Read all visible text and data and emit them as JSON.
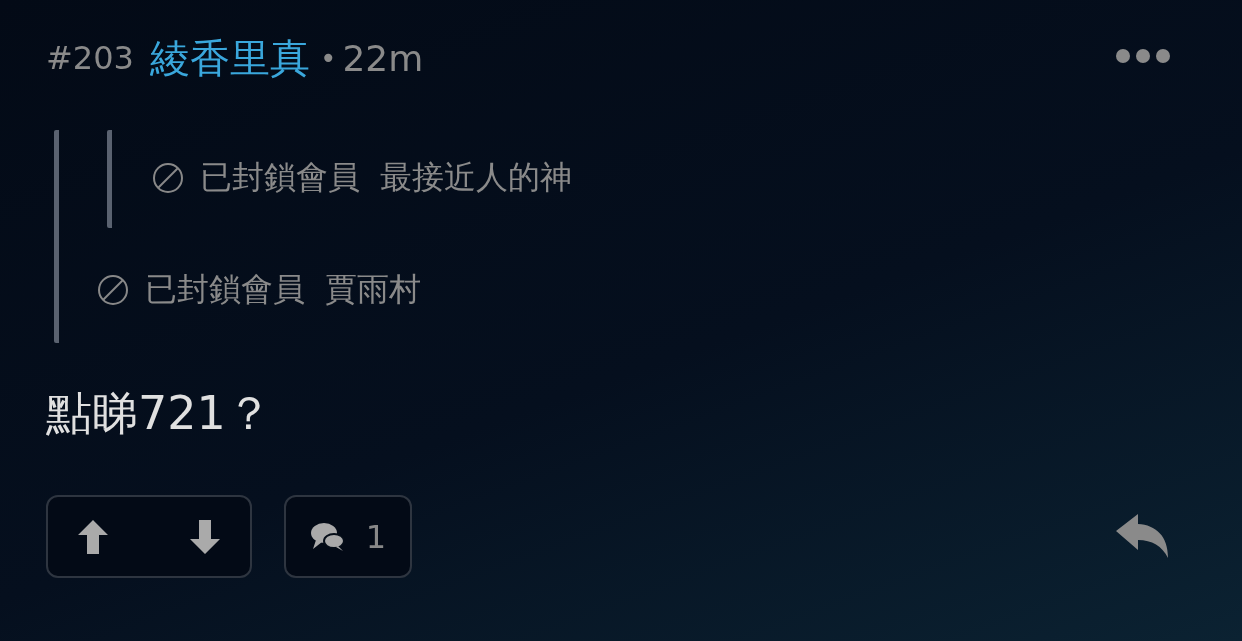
{
  "post": {
    "number": "#203",
    "author": "綾香里真",
    "separator": "•",
    "time": "22m"
  },
  "quote": {
    "label": "已封鎖會員",
    "author": "賈雨村",
    "quote": {
      "label": "已封鎖會員",
      "author": "最接近人的神"
    }
  },
  "body": "點睇721？",
  "actions": {
    "comment_count": "1"
  }
}
